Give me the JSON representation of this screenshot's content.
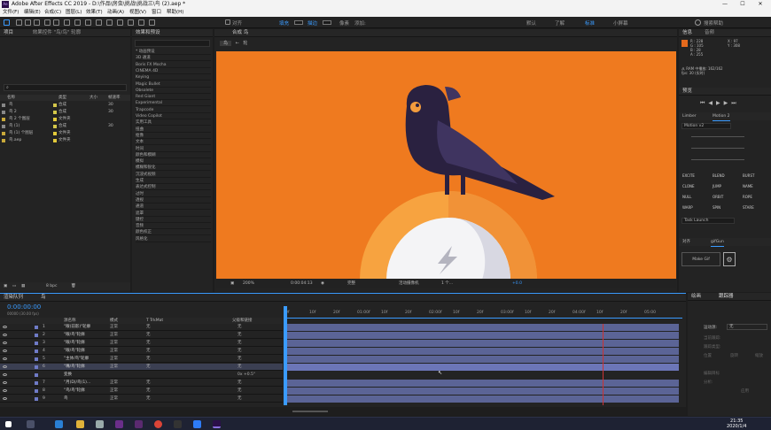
{
  "window": {
    "title": "Adobe After Effects CC 2019 - D:\\作品\\房虫\\挑战\\挑战三\\鸟 (2).aep *",
    "logo": "Ae",
    "min": "—",
    "max": "☐",
    "close": "✕"
  },
  "menu": [
    "文件(F)",
    "编辑(E)",
    "合成(C)",
    "图层(L)",
    "效果(T)",
    "动画(A)",
    "视图(V)",
    "窗口",
    "帮助(H)"
  ],
  "toolbar": {
    "snap_label": "对齐",
    "fill_label": "填充",
    "stroke_label": "描边",
    "stroke_width": "像素",
    "add_label": "添加:"
  },
  "workspaces": [
    "默认",
    "了解",
    "标准",
    "小屏幕"
  ],
  "search_help": "搜索帮助",
  "project_panel": {
    "tab": "项目",
    "tab2": "效果控件 \"鸟/鸟\" 轮廓",
    "cols": [
      "名称",
      "类型",
      "大小",
      "帧速率"
    ],
    "items": [
      {
        "name": "鸟",
        "type": "合成",
        "size": "",
        "fps": "30",
        "color": "#d3c64a"
      },
      {
        "name": "鸟 2",
        "type": "合成",
        "size": "",
        "fps": "30",
        "color": "#d3c64a"
      },
      {
        "name": "鸟 2 个图层",
        "type": "文件夹",
        "size": "",
        "fps": "",
        "color": "#e2c93a"
      },
      {
        "name": "鸟 (1)",
        "type": "合成",
        "size": "",
        "fps": "30",
        "color": "#d3c64a"
      },
      {
        "name": "鸟 (1) 个图层",
        "type": "文件夹",
        "size": "",
        "fps": "",
        "color": "#e2c93a"
      },
      {
        "name": "鸟.aep",
        "type": "文件夹",
        "size": "",
        "fps": "",
        "color": "#e2c93a"
      }
    ],
    "footer": "8 bpc"
  },
  "effects_panel": {
    "tab": "效果和预设",
    "items": [
      "* 动画预设",
      "3D 通道",
      "Boris FX Mocha",
      "CINEMA 4D",
      "Keying",
      "Magic Bullet",
      "Obsolete",
      "Red Giant",
      "Experimental",
      "Trapcode",
      "Video Copilot",
      "实用工具",
      "扭曲",
      "抠像",
      "文本",
      "时间",
      "颜色和模糊",
      "模拟",
      "模糊和锐化",
      "沉浸式视频",
      "生成",
      "表达式控制",
      "过时",
      "透视",
      "通道",
      "遮罩",
      "键控",
      "音频",
      "颜色校正",
      "风格化"
    ]
  },
  "composition": {
    "tab": "合成 鸟",
    "breadcrumb_root": "鸟",
    "breadcrumb_child": "轮",
    "zoom": "200%",
    "timecode": "0:00:04:13",
    "quality": "完整",
    "camera": "活动摄像机",
    "view": "1 个...",
    "exposure": "+0.0"
  },
  "info_panel": {
    "tab": "信息",
    "tab2": "音频",
    "r": "R : 228",
    "g": "G : 105",
    "b": "B : 28",
    "a": "A : 255",
    "x": "X : 97",
    "y": "Y : 308",
    "preview_note": "从 RAM 中播放: 162/162",
    "fps_note": "fps: 30 (实时)",
    "swatch": "#e4691c"
  },
  "preview_panel": {
    "tab": "预览"
  },
  "motion_panel": {
    "tab1": "Limber",
    "tab2": "Motion 2",
    "version": "Motion v2",
    "buttons": [
      "EXCITE",
      "BLEND",
      "BURST",
      "CLONE",
      "JUMP",
      "NAME",
      "NULL",
      "ORBIT",
      "ROPE",
      "WARP",
      "SPIN",
      "STARE"
    ],
    "task": "Task Launch"
  },
  "gifgun_panel": {
    "tab1": "对齐",
    "tab2": "gifGun",
    "make": "Make Gif"
  },
  "timeline": {
    "tab": "渲染队列",
    "tab2": "鸟",
    "timecode": "0:00:00:00",
    "fps_note": "00000 (30.00 fps)",
    "cols": [
      "源名称",
      "模式",
      "T TrkMat",
      "父级和链接"
    ],
    "layers": [
      {
        "num": "1",
        "name": "\"眼(前影)\"轮廓",
        "mode": "正常",
        "trk": "无",
        "parent": "无"
      },
      {
        "num": "2",
        "name": "\"眼/鸟\"轮廓",
        "mode": "正常",
        "trk": "无",
        "parent": "无"
      },
      {
        "num": "3",
        "name": "\"眼/鸟\"轮廓",
        "mode": "正常",
        "trk": "无",
        "parent": "无"
      },
      {
        "num": "4",
        "name": "\"眼/鸟\"轮廓",
        "mode": "正常",
        "trk": "无",
        "parent": "无"
      },
      {
        "num": "5",
        "name": "\"主体/鸟\"轮廓",
        "mode": "正常",
        "trk": "无",
        "parent": "无"
      },
      {
        "num": "6",
        "name": "\"嘴/鸟\"轮廓",
        "mode": "正常",
        "trk": "无",
        "parent": "无"
      },
      {
        "num": "",
        "name": "变换",
        "mode": "",
        "trk": "",
        "parent": "0x +0.5°"
      },
      {
        "num": "7",
        "name": "\"月(D)/鸟(1)...",
        "mode": "正常",
        "trk": "无",
        "parent": "无"
      },
      {
        "num": "8",
        "name": "\"鸟/鸟\"轮廓",
        "mode": "正常",
        "trk": "无",
        "parent": "无"
      },
      {
        "num": "9",
        "name": "鸟",
        "mode": "正常",
        "trk": "无",
        "parent": "无"
      }
    ],
    "ruler": [
      "0f",
      "10f",
      "20f",
      "01:00f",
      "10f",
      "20f",
      "02:00f",
      "10f",
      "20f",
      "03:00f",
      "10f",
      "20f",
      "04:00f",
      "10f",
      "20f",
      "05:00"
    ]
  },
  "right_dock": {
    "tab1": "绘画",
    "tab2": "跟踪器",
    "motion_src": "运动源:",
    "none": "无",
    "current": "当前跟踪:",
    "type": "跟踪类型:",
    "position": "位置",
    "rotation": "旋转",
    "scale": "缩放",
    "edit": "编辑目标",
    "analyze": "分析:",
    "apply": "应用"
  },
  "taskbar": {
    "time": "21:35",
    "date": "2020/1/4"
  }
}
